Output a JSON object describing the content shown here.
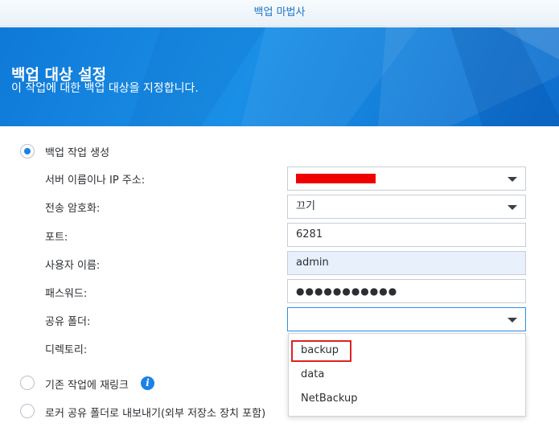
{
  "window": {
    "title": "백업 마법사"
  },
  "banner": {
    "title": "백업 대상 설정",
    "subtitle": "이 작업에 대한 백업 대상을 지정합니다."
  },
  "options": {
    "create": "백업 작업 생성",
    "relink": "기존 작업에 재링크",
    "export": "로커 공유 폴더로 내보내기(외부 저장소 장치 포함)"
  },
  "form": {
    "server_label": "서버 이름이나 IP 주소:",
    "encryption_label": "전송 암호화:",
    "encryption_value": "끄기",
    "port_label": "포트:",
    "port_value": "6281",
    "user_label": "사용자 이름:",
    "user_value": "admin",
    "password_label": "패스워드:",
    "password_value": "●●●●●●●●●●●",
    "share_label": "공유 폴더:",
    "share_value": "",
    "directory_label": "디렉토리:"
  },
  "dropdown": {
    "items": [
      "backup",
      "data",
      "NetBackup"
    ]
  },
  "icons": {
    "info": "info-icon",
    "arrow": "chevron-down-icon"
  },
  "colors": {
    "accent": "#1a82e6",
    "highlight": "#e02020",
    "redaction": "#f00000"
  }
}
